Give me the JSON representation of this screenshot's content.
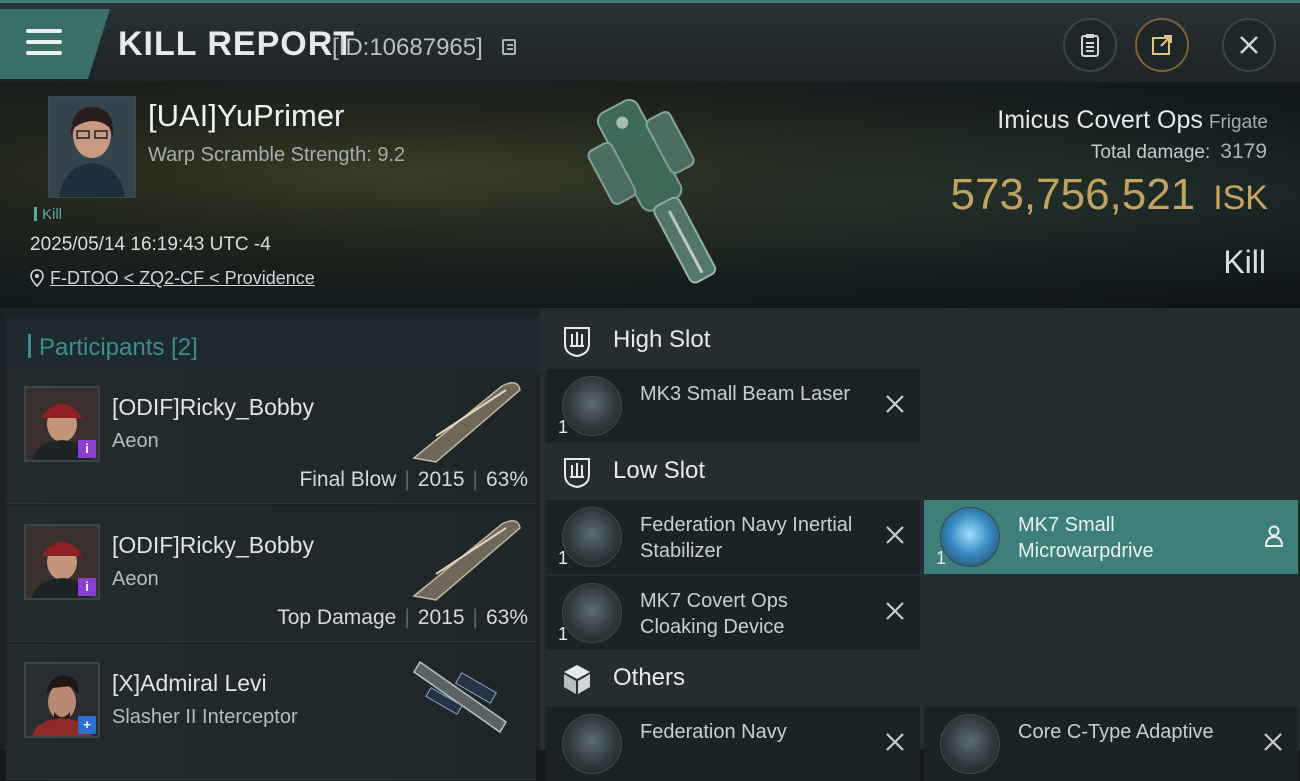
{
  "topbar": {
    "title": "KILL REPORT",
    "report_id": "[ID:10687965]"
  },
  "victim": {
    "pilot": "[UAI]YuPrimer",
    "warp_scramble": "Warp Scramble Strength: 9.2",
    "tag": "Kill",
    "datetime": "2025/05/14 16:19:43 UTC -4",
    "location": "F-DTOO < ZQ2-CF < Providence",
    "ship": "Imicus Covert Ops",
    "ship_class": "Frigate",
    "total_damage_label": "Total damage:",
    "total_damage": "3179",
    "isk_value": "573,756,521",
    "isk_unit": "ISK",
    "result": "Kill"
  },
  "participants": {
    "header": "Participants [2]",
    "rows": [
      {
        "name": "[ODIF]Ricky_Bobby",
        "ship": "Aeon",
        "role": "Final Blow",
        "damage": "2015",
        "percent": "63%",
        "badge": "i"
      },
      {
        "name": "[ODIF]Ricky_Bobby",
        "ship": "Aeon",
        "role": "Top Damage",
        "damage": "2015",
        "percent": "63%",
        "badge": "i"
      },
      {
        "name": "[X]Admiral Levi",
        "ship": "Slasher II Interceptor",
        "badge": "+"
      }
    ]
  },
  "fitting": {
    "high_slot": {
      "label": "High Slot",
      "modules": [
        {
          "name": "MK3 Small Beam Laser",
          "qty": "1"
        }
      ]
    },
    "low_slot": {
      "label": "Low Slot",
      "modules": [
        {
          "name": "Federation Navy Inertial Stabilizer",
          "qty": "1"
        },
        {
          "name": "MK7 Small Microwarpdrive",
          "qty": "1"
        },
        {
          "name": "MK7 Covert Ops Cloaking Device",
          "qty": "1"
        }
      ]
    },
    "others": {
      "label": "Others",
      "modules": [
        {
          "name": "Federation Navy"
        },
        {
          "name": "Core C-Type Adaptive"
        }
      ]
    }
  },
  "colors": {
    "accent_teal": "#3e7f7a",
    "isk_gold": "#e8b765",
    "participants_teal": "#3d8e8a"
  }
}
